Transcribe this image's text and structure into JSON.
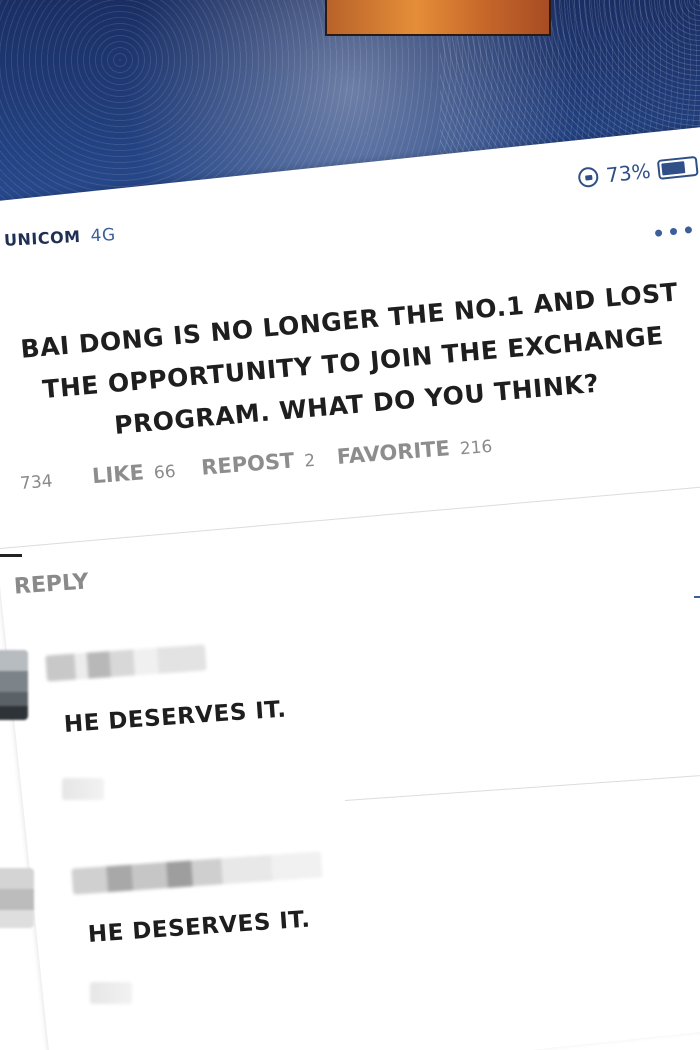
{
  "status_bar": {
    "battery_percent_label": "73%",
    "battery_level": 0.73,
    "carrier": "UNICOM",
    "network": "4G"
  },
  "post": {
    "text": "BAI DONG IS NO LONGER THE NO.1 AND LOST THE OPPORTUNITY TO JOIN THE EXCHANGE PROGRAM. WHAT DO YOU THINK?",
    "view_count": "734",
    "like_label": "LIKE",
    "like_count": "66",
    "repost_label": "REPOST",
    "repost_count": "2",
    "favorite_label": "FAVORITE",
    "favorite_count": "216"
  },
  "tabs": {
    "reply_label": "REPLY"
  },
  "comments": [
    {
      "text": "HE DESERVES IT."
    },
    {
      "text": "HE DESERVES IT."
    }
  ],
  "colors": {
    "accent": "#3c5f9a",
    "text": "#1e1e1e",
    "muted": "#8a8a8a",
    "background_top": "#22407f"
  },
  "icons": {
    "lock": "rotation-lock-icon",
    "battery": "battery-icon",
    "more": "more-dots-icon"
  }
}
